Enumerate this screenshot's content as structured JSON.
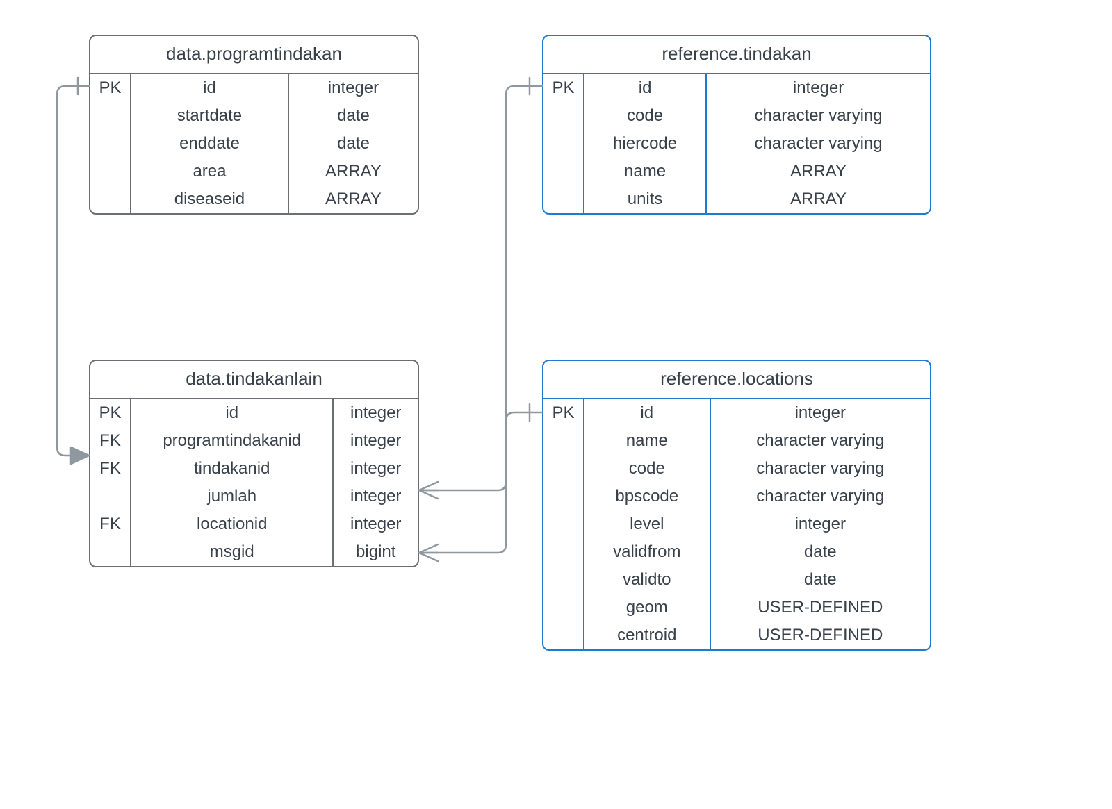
{
  "entities": {
    "programtindakan": {
      "title": "data.programtindakan",
      "cols": [
        {
          "key": "PK",
          "name": "id",
          "type": "integer"
        },
        {
          "key": "",
          "name": "startdate",
          "type": "date"
        },
        {
          "key": "",
          "name": "enddate",
          "type": "date"
        },
        {
          "key": "",
          "name": "area",
          "type": "ARRAY"
        },
        {
          "key": "",
          "name": "diseaseid",
          "type": "ARRAY"
        }
      ]
    },
    "tindakanlain": {
      "title": "data.tindakanlain",
      "cols": [
        {
          "key": "PK",
          "name": "id",
          "type": "integer"
        },
        {
          "key": "FK",
          "name": "programtindakanid",
          "type": "integer"
        },
        {
          "key": "FK",
          "name": "tindakanid",
          "type": "integer"
        },
        {
          "key": "",
          "name": "jumlah",
          "type": "integer"
        },
        {
          "key": "FK",
          "name": "locationid",
          "type": "integer"
        },
        {
          "key": "",
          "name": "msgid",
          "type": "bigint"
        }
      ]
    },
    "tindakan": {
      "title": "reference.tindakan",
      "cols": [
        {
          "key": "PK",
          "name": "id",
          "type": "integer"
        },
        {
          "key": "",
          "name": "code",
          "type": "character varying"
        },
        {
          "key": "",
          "name": "hiercode",
          "type": "character varying"
        },
        {
          "key": "",
          "name": "name",
          "type": "ARRAY"
        },
        {
          "key": "",
          "name": "units",
          "type": "ARRAY"
        }
      ]
    },
    "locations": {
      "title": "reference.locations",
      "cols": [
        {
          "key": "PK",
          "name": "id",
          "type": "integer"
        },
        {
          "key": "",
          "name": "name",
          "type": "character varying"
        },
        {
          "key": "",
          "name": "code",
          "type": "character varying"
        },
        {
          "key": "",
          "name": "bpscode",
          "type": "character varying"
        },
        {
          "key": "",
          "name": "level",
          "type": "integer"
        },
        {
          "key": "",
          "name": "validfrom",
          "type": "date"
        },
        {
          "key": "",
          "name": "validto",
          "type": "date"
        },
        {
          "key": "",
          "name": "geom",
          "type": "USER-DEFINED"
        },
        {
          "key": "",
          "name": "centroid",
          "type": "USER-DEFINED"
        }
      ]
    }
  },
  "chart_data": {
    "type": "table",
    "description": "Entity-relationship diagram with 4 tables",
    "entities": [
      {
        "name": "data.programtindakan",
        "columns": 5,
        "style": "gray"
      },
      {
        "name": "data.tindakanlain",
        "columns": 6,
        "style": "gray"
      },
      {
        "name": "reference.tindakan",
        "columns": 5,
        "style": "blue"
      },
      {
        "name": "reference.locations",
        "columns": 9,
        "style": "blue"
      }
    ],
    "relationships": [
      {
        "from": "data.tindakanlain.programtindakanid",
        "to": "data.programtindakan.id",
        "cardinality": "many-to-one"
      },
      {
        "from": "data.tindakanlain.tindakanid",
        "to": "reference.tindakan.id",
        "cardinality": "many-to-one"
      },
      {
        "from": "data.tindakanlain.locationid",
        "to": "reference.locations.id",
        "cardinality": "many-to-one"
      }
    ]
  }
}
